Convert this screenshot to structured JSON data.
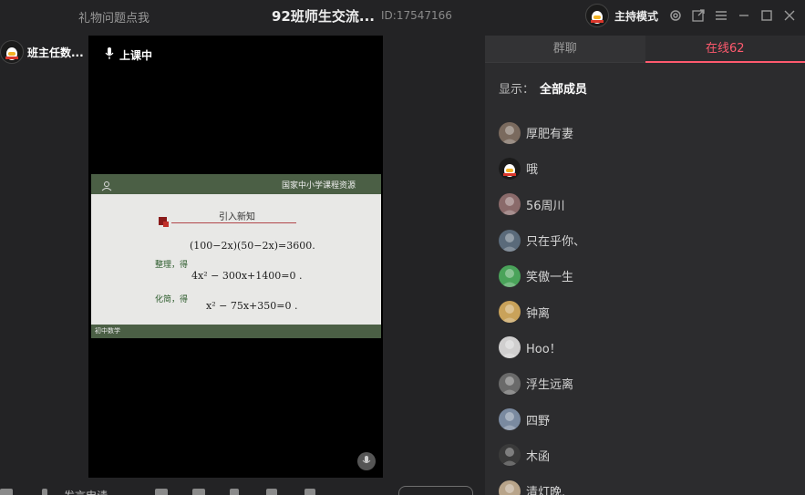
{
  "titlebar": {
    "gift_link": "礼物问题点我",
    "room_title": "92班师生交流...",
    "room_id": "ID:17547166",
    "host_label": "主持模式",
    "icons": [
      "gear-icon",
      "popout-icon",
      "menu-icon",
      "minimize-icon",
      "maximize-icon",
      "close-icon"
    ]
  },
  "presenter": {
    "name": "班主任数..."
  },
  "video": {
    "status": "上课中"
  },
  "slide": {
    "brand": "国家中小学课程资源",
    "heading": "引入新知",
    "eq1": "(100−2x)(50−2x)=3600.",
    "note1": "整理，得",
    "eq2": "4x² − 300x+1400=0 .",
    "note2": "化简，得",
    "eq3": "x² − 75x+350=0 .",
    "tag": "初中数学"
  },
  "bottom_bar": {
    "apply_speak": "发言申请"
  },
  "side": {
    "tabs": [
      {
        "label": "群聊",
        "active": false
      },
      {
        "label": "在线62",
        "active": true
      }
    ],
    "filter_label": "显示：",
    "filter_value": "全部成员",
    "members": [
      {
        "name": "厚肥有妻",
        "color": "#7a6a5e"
      },
      {
        "name": "哦",
        "color": "#1b1b1b"
      },
      {
        "name": "56周川",
        "color": "#8a6a6a"
      },
      {
        "name": "只在乎你、",
        "color": "#5a6a7a"
      },
      {
        "name": "笑傲一生",
        "color": "#4aa35a"
      },
      {
        "name": "钟离",
        "color": "#c9a25a"
      },
      {
        "name": "Hoo！",
        "color": "#d0cfcf"
      },
      {
        "name": "浮生远离",
        "color": "#6a6a6a"
      },
      {
        "name": "四野",
        "color": "#7a8aa0"
      },
      {
        "name": "木函",
        "color": "#3a3a3a"
      },
      {
        "name": "清灯晚.",
        "color": "#b8a48a"
      }
    ]
  },
  "colors": {
    "accent": "#ff5a6e",
    "panel": "#2c2c2e",
    "bg": "#232325"
  }
}
